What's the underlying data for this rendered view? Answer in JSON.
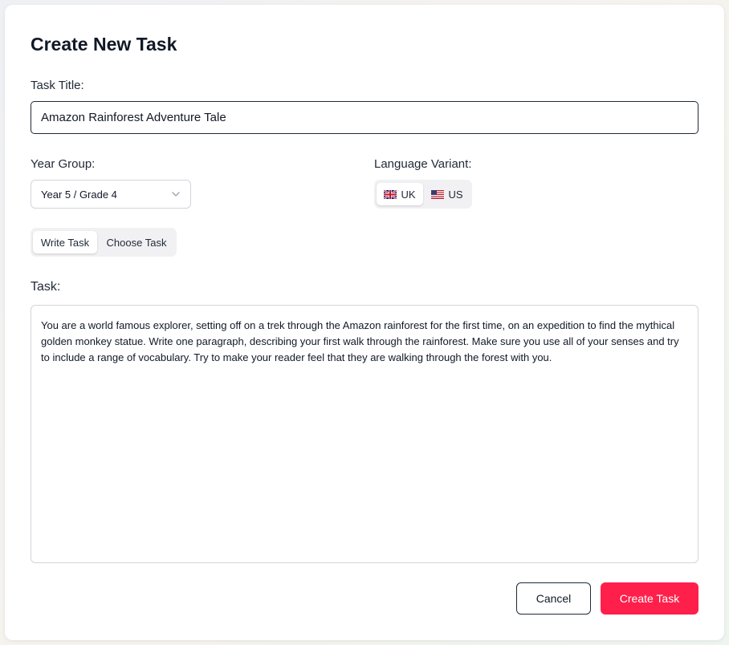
{
  "dialog": {
    "title": "Create New Task"
  },
  "task_title": {
    "label": "Task Title:",
    "value": "Amazon Rainforest Adventure Tale"
  },
  "year_group": {
    "label": "Year Group:",
    "selected": "Year 5 / Grade 4"
  },
  "language_variant": {
    "label": "Language Variant:",
    "options": [
      {
        "label": "UK",
        "icon": "uk-flag-icon",
        "active": true
      },
      {
        "label": "US",
        "icon": "us-flag-icon",
        "active": false
      }
    ]
  },
  "mode_tabs": {
    "options": [
      {
        "label": "Write Task",
        "active": true
      },
      {
        "label": "Choose Task",
        "active": false
      }
    ]
  },
  "task": {
    "label": "Task:",
    "value": "You are a world famous explorer, setting off on a trek through the Amazon rainforest for the first time, on an expedition to find the mythical golden monkey statue. Write one paragraph, describing your first walk through the rainforest. Make sure you use all of your senses and try to include a range of vocabulary. Try to make your reader feel that they are walking through the forest with you."
  },
  "actions": {
    "cancel_label": "Cancel",
    "create_label": "Create Task"
  },
  "colors": {
    "accent": "#ff1f4b",
    "text": "#111827",
    "border": "#d1d5db"
  }
}
